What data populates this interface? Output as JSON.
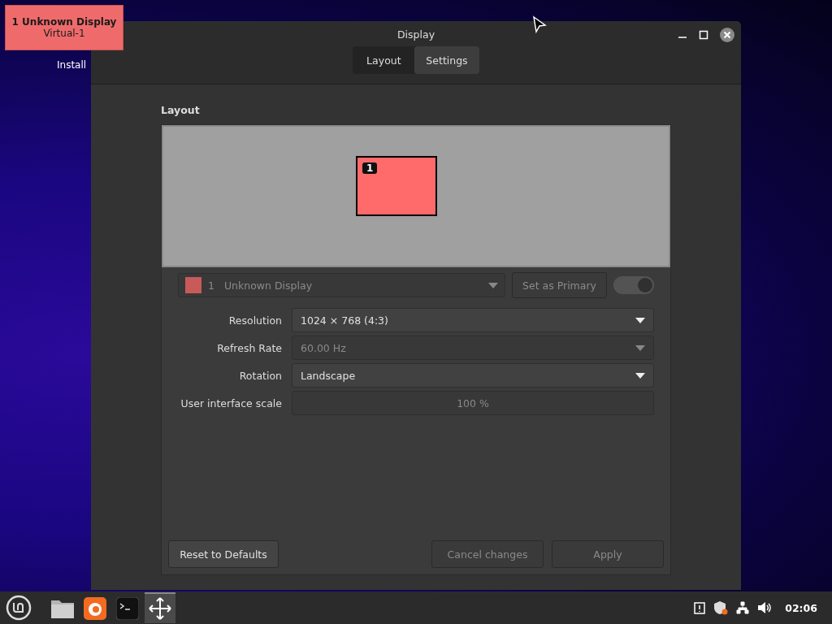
{
  "desktop": {
    "icons": [
      {
        "label": "Install"
      }
    ],
    "osd": {
      "number": "1",
      "name": "Unknown Display",
      "output": "Virtual-1",
      "color": "#ef6b6b"
    }
  },
  "window": {
    "title": "Display",
    "tabs": [
      {
        "label": "Layout",
        "selected": false
      },
      {
        "label": "Settings",
        "selected": true
      }
    ]
  },
  "layout": {
    "heading": "Layout",
    "monitors": [
      {
        "number": "1",
        "color": "#ff6b6b"
      }
    ]
  },
  "display_selector": {
    "number": "1",
    "name": "Unknown Display",
    "color": "#c85a5a",
    "disabled": true
  },
  "primary_button": {
    "label": "Set as Primary",
    "disabled": true
  },
  "enabled_switch": {
    "on": true,
    "disabled": true
  },
  "settings": [
    {
      "label": "Resolution",
      "value": "1024 × 768 (4:3)",
      "kind": "dropdown",
      "disabled": false
    },
    {
      "label": "Refresh Rate",
      "value": "60.00 Hz",
      "kind": "dropdown",
      "disabled": true
    },
    {
      "label": "Rotation",
      "value": "Landscape",
      "kind": "dropdown",
      "disabled": false
    },
    {
      "label": "User interface scale",
      "value": "100 %",
      "kind": "scale",
      "disabled": true
    }
  ],
  "buttons": [
    {
      "label": "Reset to Defaults",
      "disabled": false
    },
    {
      "label": "Cancel changes",
      "disabled": true
    },
    {
      "label": "Apply",
      "disabled": true
    }
  ],
  "taskbar": {
    "launchers": [
      {
        "kind": "files",
        "selected": false
      },
      {
        "kind": "browser",
        "selected": false
      },
      {
        "kind": "terminal",
        "selected": false
      },
      {
        "kind": "move",
        "selected": true
      }
    ],
    "clock": "02:06"
  }
}
